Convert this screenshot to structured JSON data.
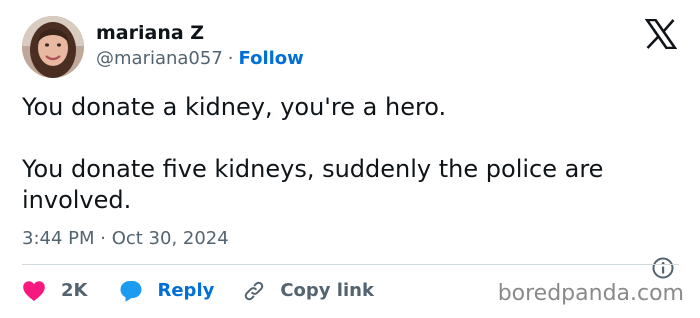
{
  "author": {
    "name": "mariana Z",
    "handle": "@mariana057",
    "separator": "·",
    "follow_label": "Follow"
  },
  "tweet": {
    "paragraphs": [
      "You donate a kidney, you're a hero.",
      "You donate five kidneys, suddenly the police are involved."
    ],
    "timestamp": "3:44 PM · Oct 30, 2024"
  },
  "actions": {
    "like_count": "2K",
    "reply_label": "Reply",
    "copy_label": "Copy link"
  },
  "watermark": "boredpanda.com",
  "icons": {
    "brand": "x-logo-icon",
    "like": "heart-icon",
    "reply": "speech-bubble-icon",
    "copy": "link-icon",
    "info": "info-icon"
  },
  "colors": {
    "text": "#0f1419",
    "muted": "#536471",
    "link": "#006fd6",
    "like": "#f91880",
    "reply": "#1d9bf0",
    "divider": "#cfd9de",
    "watermark": "#8a8a8a"
  }
}
